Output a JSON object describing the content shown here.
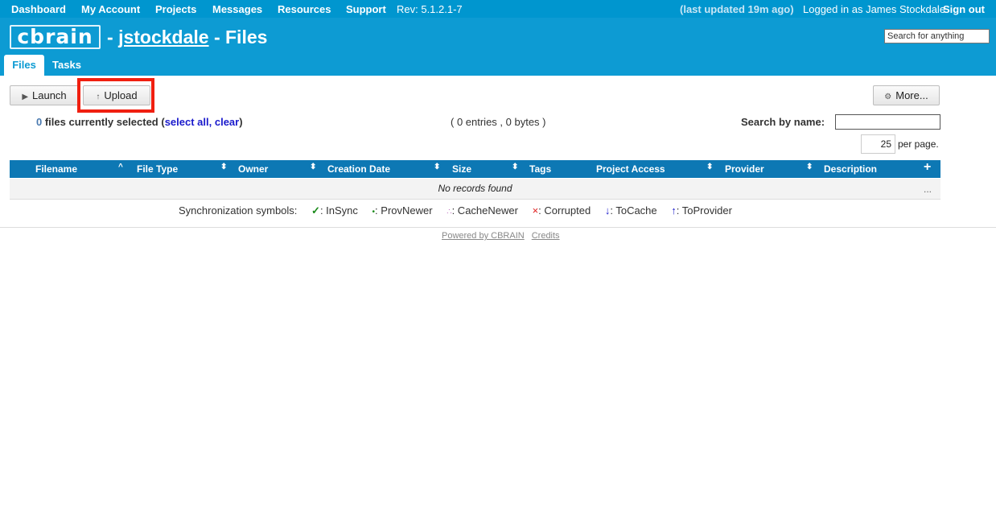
{
  "topnav": {
    "items": [
      "Dashboard",
      "My Account",
      "Projects",
      "Messages",
      "Resources",
      "Support"
    ],
    "revision": "Rev: 5.1.2.1-7",
    "last_updated": "(last updated 19m ago)",
    "logged_in": "Logged in as James Stockdale",
    "sign_out": "Sign out"
  },
  "header": {
    "logo_text": "cbrain",
    "title_prefix": "- ",
    "username": "jstockdale",
    "title_suffix": " - Files",
    "search_placeholder": "Search for anything"
  },
  "tabs": [
    {
      "label": "Files",
      "active": true
    },
    {
      "label": "Tasks",
      "active": false
    }
  ],
  "toolbar": {
    "launch_icon": "▶",
    "launch_label": "Launch",
    "upload_icon": "↑",
    "upload_label": "Upload",
    "more_icon": "⚙",
    "more_label": "More..."
  },
  "selection": {
    "count": "0",
    "text": " files currently selected (",
    "select_all": "select all,",
    "clear": "clear",
    "close": ")"
  },
  "entries": "( 0 entries , 0 bytes )",
  "search_by_name_label": "Search by name:",
  "per_page": {
    "value": "25",
    "label": "per page."
  },
  "table": {
    "columns": [
      "Filename",
      "File Type",
      "Owner",
      "Creation Date",
      "Size",
      "Tags",
      "Project Access",
      "Provider",
      "Description"
    ],
    "add_column": "+",
    "empty_message": "No records found",
    "row_menu": "..."
  },
  "sync_legend": {
    "label": "Synchronization symbols:",
    "items": [
      {
        "symbol": "✓",
        "text": ": InSync"
      },
      {
        "symbol": "•",
        "text": ": ProvNewer"
      },
      {
        "symbol": "∴",
        "text": ": CacheNewer"
      },
      {
        "symbol": "×",
        "text": ": Corrupted"
      },
      {
        "symbol": "↓",
        "text": ": ToCache"
      },
      {
        "symbol": "↑",
        "text": ": ToProvider"
      }
    ]
  },
  "footer": {
    "powered_by": "Powered by CBRAIN",
    "credits": "Credits"
  },
  "colors": {
    "nav": "#0096cf",
    "header": "#0d9bd3",
    "table_header": "#0d78b4",
    "highlight": "#f01f10"
  }
}
